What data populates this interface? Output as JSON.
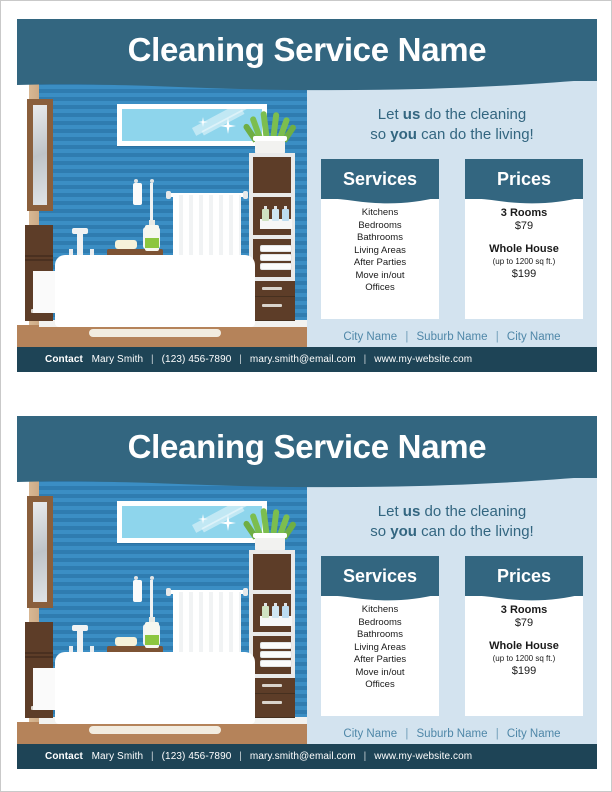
{
  "flyer": {
    "title": "Cleaning Service Name",
    "tagline": {
      "line1_pre": "Let ",
      "line1_bold": "us",
      "line1_post": " do the cleaning",
      "line2_pre": "so ",
      "line2_bold": "you",
      "line2_post": " can do the living!"
    },
    "services_card": {
      "heading": "Services",
      "items": [
        "Kitchens",
        "Bedrooms",
        "Bathrooms",
        "Living Areas",
        "After Parties",
        "Move in/out",
        "Offices"
      ]
    },
    "prices_card": {
      "heading": "Prices",
      "entries": [
        {
          "name": "3 Rooms",
          "note": "",
          "price": "$79"
        },
        {
          "name": "Whole House",
          "note": "(up to 1200 sq ft.)",
          "price": "$199"
        }
      ]
    },
    "locations": [
      "City Name",
      "Suburb Name",
      "City Name"
    ],
    "locations_separator": "|",
    "contact": {
      "label": "Contact",
      "name": "Mary Smith",
      "phone": "(123) 456-7890",
      "email": "mary.smith@email.com",
      "website": "www.my-website.com",
      "separator": "|"
    },
    "illustration": {
      "name": "bathroom-illustration",
      "elements": [
        "mirror-window-with-sparkles",
        "potted-plant",
        "shelf-unit-with-bottles-and-towels",
        "hanging-towel",
        "toilet-brush",
        "bathtub-with-faucet",
        "wooden-stool-with-soap-and-bottle",
        "wall-mirror",
        "floor-cabinet",
        "bath-mat"
      ]
    }
  },
  "colors": {
    "brand_dark": "#336680",
    "contact_bar": "#1e4456",
    "panel_light": "#d3e3ef",
    "wall_blue": "#3b8ec4",
    "mirror_glass": "#8ed5ec",
    "wood_brown": "#5d3d28",
    "floor_brown": "#b5835a",
    "city_text": "#4f87a8",
    "plant_green": "#7cbe4e"
  },
  "copies": 2
}
